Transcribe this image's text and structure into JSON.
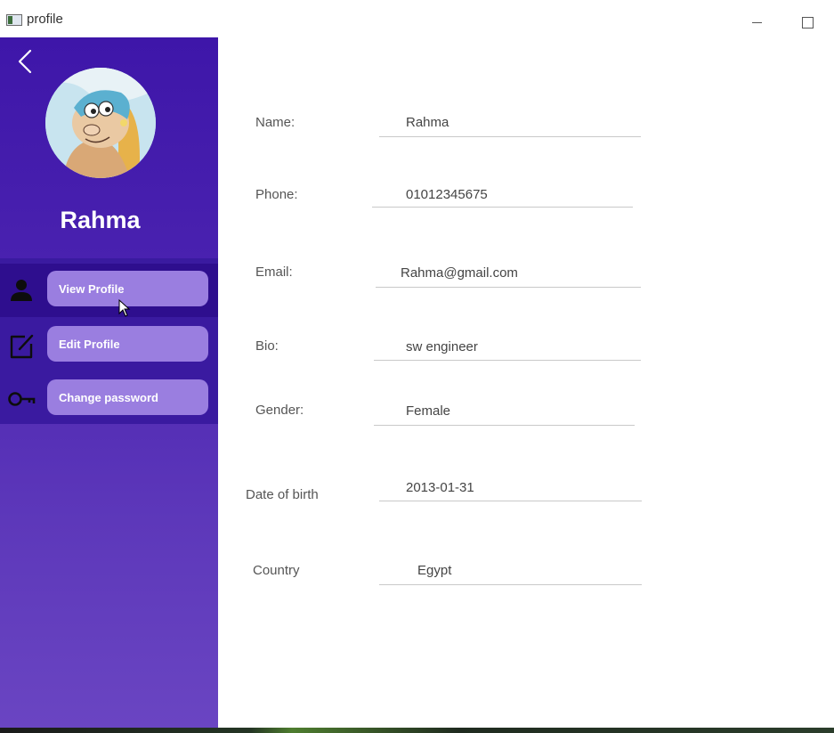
{
  "window": {
    "title": "profile"
  },
  "sidebar": {
    "user_name": "Rahma",
    "menu": [
      {
        "label": "View Profile",
        "icon": "person-icon",
        "active": true
      },
      {
        "label": "Edit Profile",
        "icon": "edit-icon",
        "active": false
      },
      {
        "label": "Change password",
        "icon": "key-icon",
        "active": false
      }
    ]
  },
  "profile": {
    "name_label": "Name:",
    "name_value": "Rahma",
    "phone_label": "Phone:",
    "phone_value": "01012345675",
    "email_label": "Email:",
    "email_value": "Rahma@gmail.com",
    "bio_label": "Bio:",
    "bio_value": "sw engineer",
    "gender_label": "Gender:",
    "gender_value": "Female",
    "dob_label": "Date of birth",
    "dob_value": "2013-01-31",
    "country_label": "Country",
    "country_value": "Egypt"
  },
  "colors": {
    "sidebar_top": "#3e16a9",
    "sidebar_bottom": "#6a45c2",
    "menu_button": "#9a7ee0",
    "active_row": "#2e0e8e"
  }
}
